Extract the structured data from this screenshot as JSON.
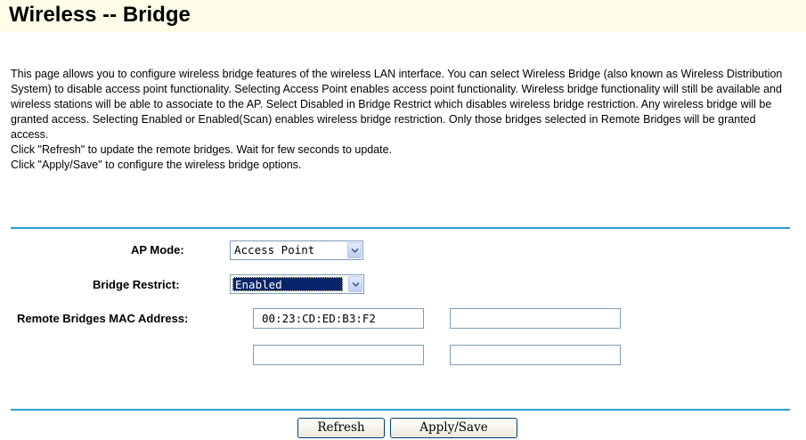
{
  "page": {
    "title": "Wireless -- Bridge",
    "description": [
      "This page allows you to configure wireless bridge features of the wireless LAN interface. You can select Wireless Bridge (also known as Wireless Distribution System) to disable access point functionality. Selecting Access Point enables access point functionality. Wireless bridge functionality will still be available and wireless stations will be able to associate to the AP. Select Disabled in Bridge Restrict which disables wireless bridge restriction. Any wireless bridge will be granted access. Selecting Enabled or Enabled(Scan) enables wireless bridge restriction. Only those bridges selected in Remote Bridges will be granted access.",
      "Click \"Refresh\" to update the remote bridges. Wait for few seconds to update.",
      "Click \"Apply/Save\" to configure the wireless bridge options."
    ]
  },
  "form": {
    "ap_mode": {
      "label": "AP Mode:",
      "selected": "Access Point"
    },
    "bridge_restrict": {
      "label": "Bridge Restrict:",
      "selected": "Enabled"
    },
    "remote_bridges": {
      "label": "Remote Bridges MAC Address:",
      "mac_fields": [
        "00:23:CD:ED:B3:F2",
        "",
        "",
        ""
      ]
    }
  },
  "buttons": {
    "refresh": "Refresh",
    "apply_save": "Apply/Save"
  },
  "colors": {
    "title_background": "#fffde7",
    "divider": "#2a9fd6",
    "selection_highlight": "#0a246a"
  }
}
